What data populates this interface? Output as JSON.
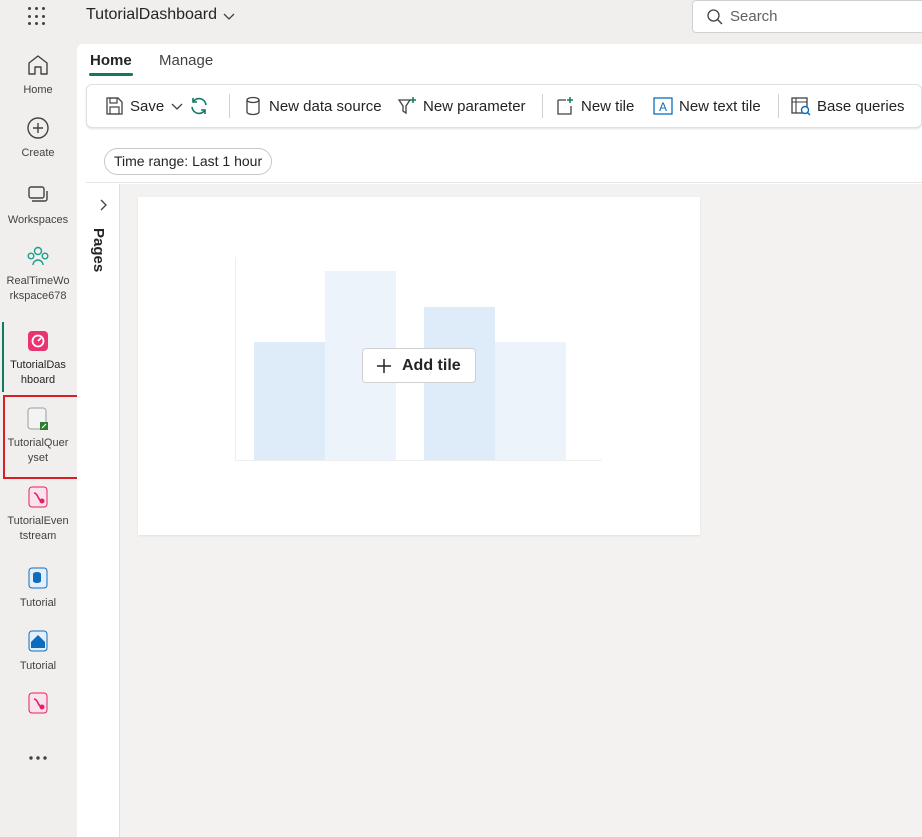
{
  "header": {
    "app_title": "TutorialDashboard",
    "search_placeholder": "Search"
  },
  "rail": {
    "items": [
      {
        "label": "Home",
        "icon": "home-icon"
      },
      {
        "label": "Create",
        "icon": "plus-circle-icon"
      },
      {
        "label": "Workspaces",
        "icon": "workspaces-icon"
      },
      {
        "label_line1": "RealTimeWo",
        "label_line2": "rkspace678",
        "icon": "people-icon"
      },
      {
        "label_line1": "TutorialDas",
        "label_line2": "hboard",
        "icon": "dashboard-icon",
        "active": true
      },
      {
        "label_line1": "TutorialQuer",
        "label_line2": "yset",
        "icon": "queryset-icon",
        "highlighted": true
      },
      {
        "label_line1": "TutorialEven",
        "label_line2": "tstream",
        "icon": "eventstream-icon"
      },
      {
        "label": "Tutorial",
        "icon": "eventhouse-icon"
      },
      {
        "label": "Tutorial",
        "icon": "database-icon"
      },
      {
        "label": "",
        "icon": "eventstream-icon"
      },
      {
        "label": "...",
        "icon": "more-icon"
      }
    ]
  },
  "tabs": [
    {
      "label": "Home",
      "active": true
    },
    {
      "label": "Manage",
      "active": false
    }
  ],
  "toolbar": {
    "save_label": "Save",
    "new_data_source_label": "New data source",
    "new_parameter_label": "New parameter",
    "new_tile_label": "New tile",
    "new_text_tile_label": "New text tile",
    "base_queries_label": "Base queries"
  },
  "filters": {
    "time_range_prefix": "Time range:",
    "time_range_value": "Last 1 hour"
  },
  "pages_label": "Pages",
  "tile": {
    "add_tile_label": "Add tile"
  },
  "colors": {
    "accent": "#117865",
    "highlight": "#d71f26",
    "bar_dark": "#deebf8",
    "bar_light": "#ecf3fb"
  }
}
